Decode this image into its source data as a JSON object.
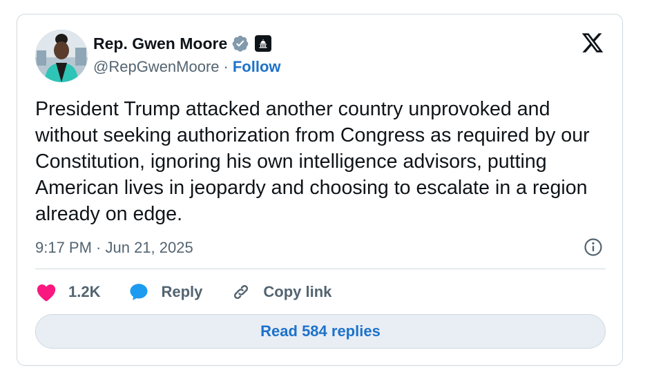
{
  "author": {
    "name": "Rep. Gwen Moore",
    "handle": "@RepGwenMoore",
    "separator": "·",
    "follow_label": "Follow",
    "verified_icon": "verified-badge-icon",
    "affiliation_icon": "capitol-affiliation-icon"
  },
  "platform": {
    "logo_icon": "x-logo-icon"
  },
  "tweet": {
    "text": "President Trump attacked another country unprovoked and without seeking authorization from Congress as required by our Constitution, ignoring his own intelligence advisors, putting American lives in jeopardy and choosing to escalate in a region already on edge.",
    "timestamp": "9:17 PM · Jun 21, 2025"
  },
  "actions": {
    "like_count": "1.2K",
    "reply_label": "Reply",
    "copy_link_label": "Copy link"
  },
  "read_replies_label": "Read 584 replies",
  "colors": {
    "link_blue": "#1d72c9",
    "like_pink": "#f91880",
    "reply_blue": "#1d9bf0",
    "muted_text": "#536471",
    "border": "#cfd9de"
  }
}
